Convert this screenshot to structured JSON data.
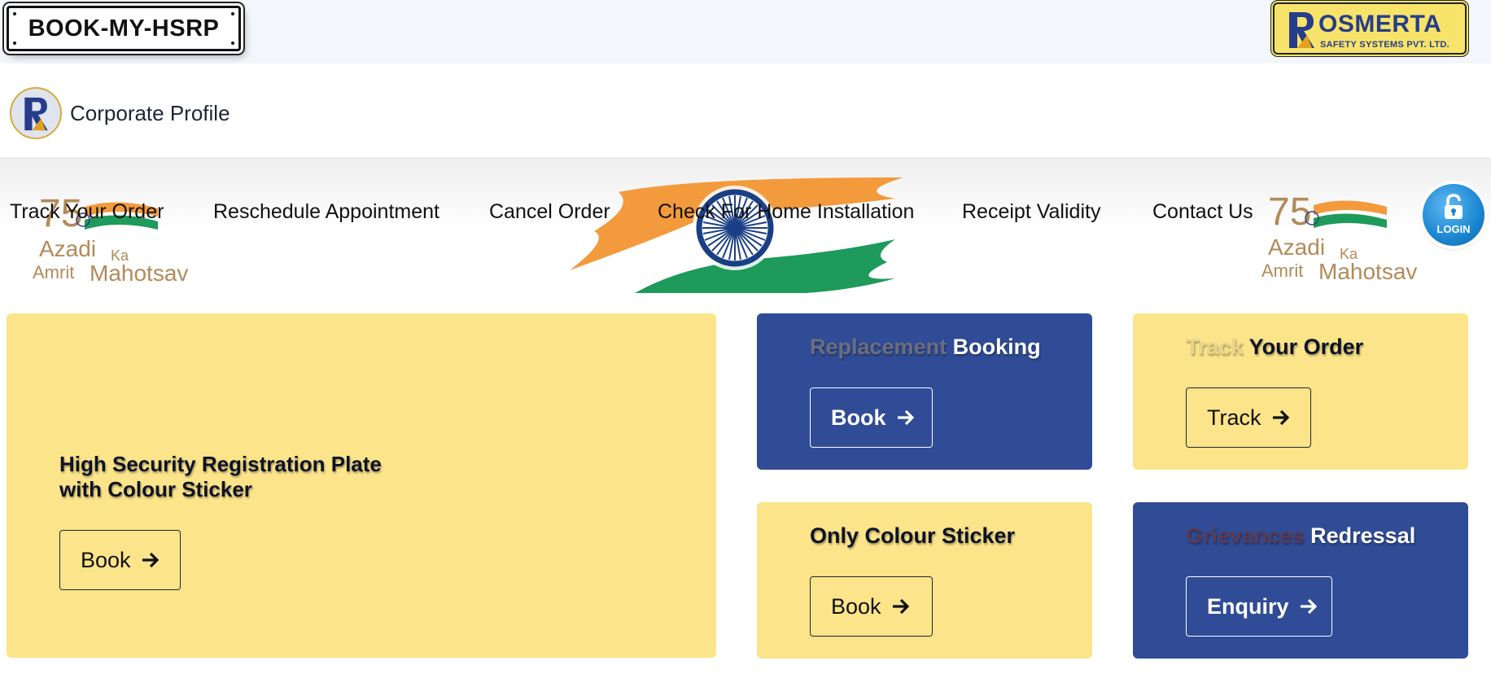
{
  "header": {
    "plate_text": "BOOK-MY-HSRP",
    "company_logo": {
      "brand": "OSMERTA",
      "subtitle": "SAFETY SYSTEMS PVT. LTD."
    }
  },
  "corporate": {
    "label": "Corporate Profile"
  },
  "nav": {
    "items": [
      "Track Your Order",
      "Reschedule Appointment",
      "Cancel Order",
      "Check For Home Installation",
      "Receipt Validity",
      "Contact Us"
    ],
    "login_label": "LOGIN"
  },
  "azadi_logo": {
    "line1": "Azadi",
    "ka": "Ka",
    "line2": "Amrit",
    "line3": "Mahotsav",
    "number": "75"
  },
  "cards": {
    "hsrp": {
      "title_line1": "High Security Registration Plate",
      "title_line2": "with Colour Sticker",
      "button": "Book"
    },
    "replacement": {
      "title_prefix": "Replacement",
      "title_main": "Booking",
      "button": "Book"
    },
    "track": {
      "title_prefix": "Track",
      "title_main": "Your Order",
      "button": "Track"
    },
    "sticker": {
      "title": "Only Colour Sticker",
      "button": "Book"
    },
    "grievance": {
      "title_prefix": "Grievances",
      "title_main": "Redressal",
      "button": "Enquiry"
    }
  },
  "colors": {
    "card_yellow": "#fbe48a",
    "card_blue": "#304c96",
    "brand_blue": "#263d8c",
    "saffron": "#f39a3c",
    "green": "#1e9a5a"
  },
  "icons": [
    "r-logo-icon",
    "arrow-right-icon",
    "lock-icon",
    "ashoka-chakra-icon"
  ]
}
